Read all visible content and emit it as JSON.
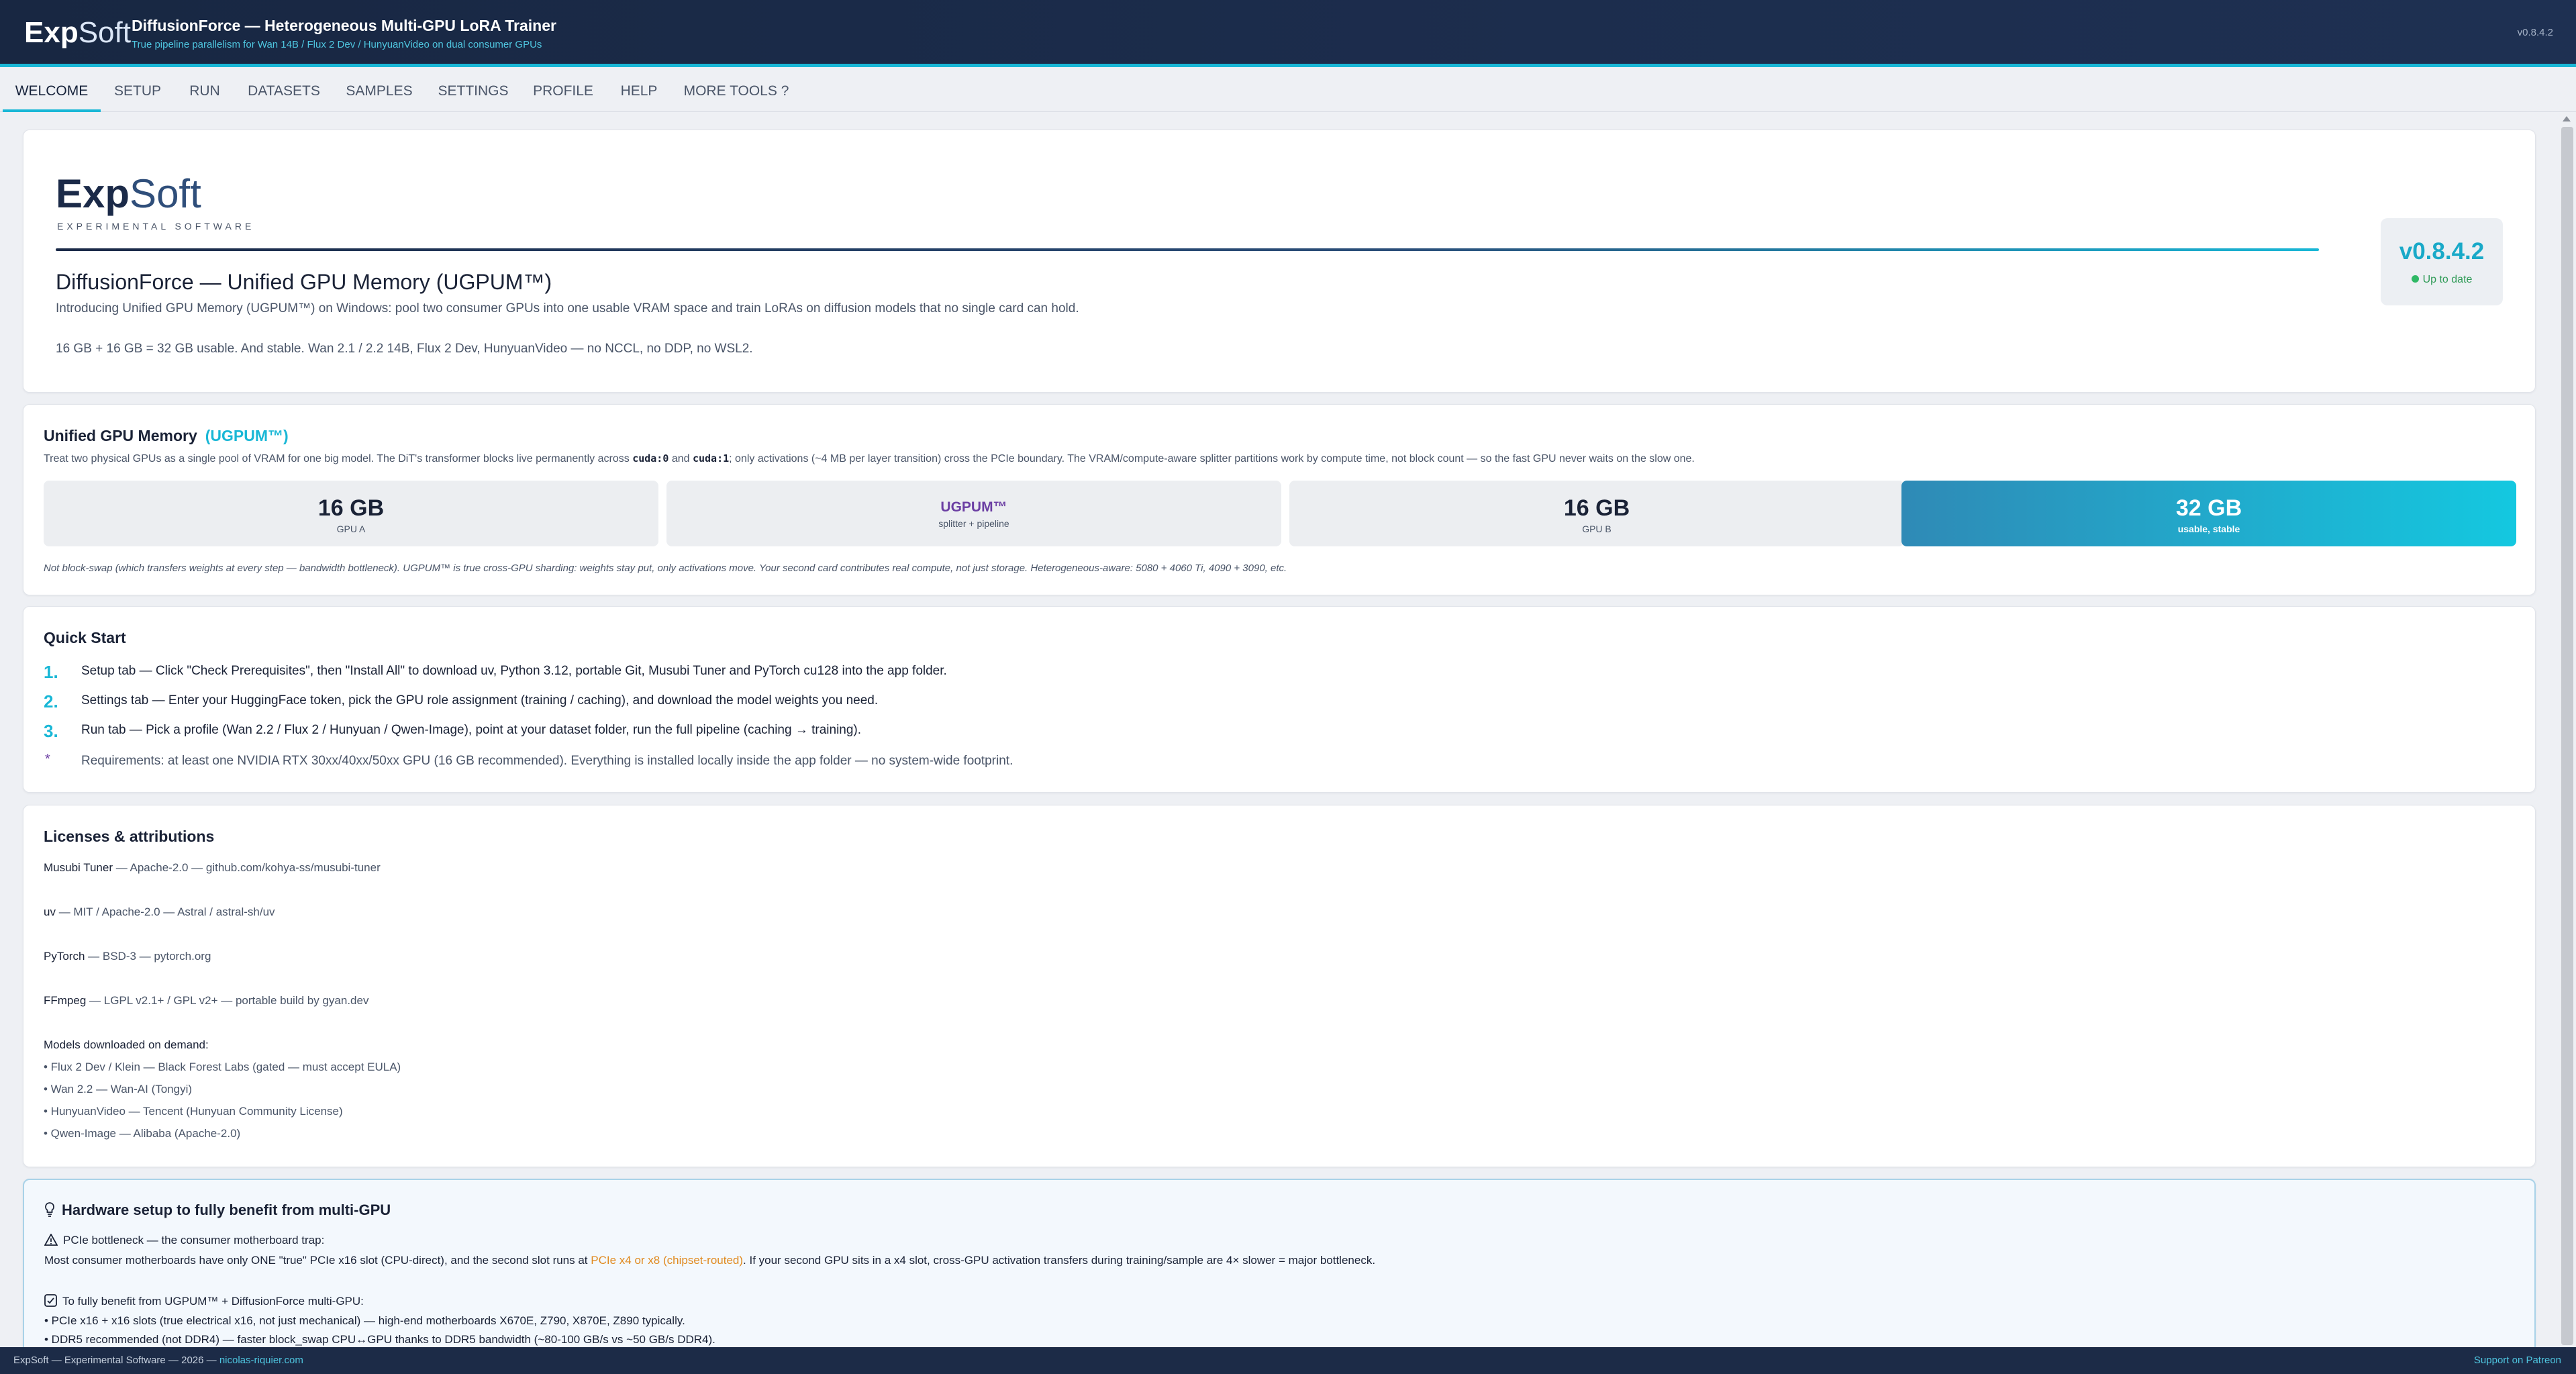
{
  "header": {
    "logo_bold": "Exp",
    "logo_light": "Soft",
    "title": "DiffusionForce — Heterogeneous Multi-GPU LoRA Trainer",
    "subtitle": "True pipeline parallelism for Wan 14B / Flux 2 Dev / HunyuanVideo on dual consumer GPUs",
    "version": "v0.8.4.2"
  },
  "tabs": [
    "WELCOME",
    "SETUP",
    "RUN",
    "DATASETS",
    "SAMPLES",
    "SETTINGS",
    "PROFILE",
    "HELP",
    "MORE TOOLS ?"
  ],
  "hero": {
    "logo_bold": "Exp",
    "logo_light": "Soft",
    "tagline": "EXPERIMENTAL SOFTWARE",
    "title": "DiffusionForce — Unified GPU Memory (UGPUM™)",
    "description": "Introducing Unified GPU Memory (UGPUM™) on Windows: pool two consumer GPUs into one usable VRAM space and train LoRAs on diffusion models that no single card can hold.",
    "stats": "16 GB + 16 GB = 32 GB usable. And stable. Wan 2.1 / 2.2 14B, Flux 2 Dev, HunyuanVideo — no NCCL, no DDP, no WSL2.",
    "version": "v0.8.4.2",
    "version_status": "Up to date"
  },
  "ugpum": {
    "title": "Unified GPU Memory",
    "title_accent": "(UGPUM™)",
    "desc_part1": "Treat two physical GPUs as a single pool of VRAM for one big model. The DiT's transformer blocks live permanently across ",
    "code1": "cuda:0",
    "desc_and": " and ",
    "code2": "cuda:1",
    "desc_part2": "; only activations (~4 MB per layer transition) cross the PCIe boundary. The VRAM/compute-aware splitter partitions work by compute time, not block count — so the fast GPU never waits on the slow one.",
    "boxes": [
      {
        "big": "16 GB",
        "small": "GPU A"
      },
      {
        "big": "UGPUM™",
        "small": "splitter + pipeline"
      },
      {
        "big": "16 GB",
        "small": "GPU B"
      },
      {
        "big": "32 GB",
        "small": "usable, stable"
      }
    ],
    "note": "Not block-swap (which transfers weights at every step — bandwidth bottleneck). UGPUM™ is true cross-GPU sharding: weights stay put, only activations move. Your second card contributes real compute, not just storage. Heterogeneous-aware: 5080 + 4060 Ti, 4090 + 3090, etc."
  },
  "quickstart": {
    "title": "Quick Start",
    "steps": [
      {
        "num": "1.",
        "text": "Setup tab — Click \"Check Prerequisites\", then \"Install All\" to download uv, Python 3.12, portable Git, Musubi Tuner and PyTorch cu128 into the app folder."
      },
      {
        "num": "2.",
        "text": "Settings tab — Enter your HuggingFace token, pick the GPU role assignment (training / caching), and download the model weights you need."
      },
      {
        "num": "3.",
        "text": "Run tab — Pick a profile (Wan 2.2 / Flux 2 / Hunyuan / Qwen-Image), point at your dataset folder, run the full pipeline (caching → training)."
      }
    ],
    "note_star": "*",
    "note": "Requirements: at least one NVIDIA RTX 30xx/40xx/50xx GPU (16 GB recommended). Everything is installed locally inside the app folder — no system-wide footprint."
  },
  "licenses": {
    "title": "Licenses & attributions",
    "items": [
      {
        "name": "Musubi Tuner",
        "detail": " — Apache-2.0 — github.com/kohya-ss/musubi-tuner"
      },
      {
        "name": "uv",
        "detail": " — MIT / Apache-2.0 — Astral / astral-sh/uv"
      },
      {
        "name": "PyTorch",
        "detail": " — BSD-3 — pytorch.org"
      },
      {
        "name": "FFmpeg",
        "detail": " — LGPL v2.1+ / GPL v2+ — portable build by gyan.dev"
      }
    ],
    "models_header": "Models downloaded on demand:",
    "models": [
      "• Flux 2 Dev / Klein — Black Forest Labs (gated — must accept EULA)",
      "• Wan 2.2 — Wan-AI (Tongyi)",
      "• HunyuanVideo — Tencent (Hunyuan Community License)",
      "• Qwen-Image — Alibaba (Apache-2.0)"
    ]
  },
  "hardware": {
    "title": "Hardware setup to fully benefit from multi-GPU",
    "warning_title": "PCIe bottleneck — the consumer motherboard trap:",
    "warning_part1": "Most consumer motherboards have only ONE \"true\" PCIe x16 slot (CPU-direct), and the second slot runs at ",
    "warning_highlight": "PCIe x4 or x8 (chipset-routed)",
    "warning_part2": ". If your second GPU sits in a x4 slot, cross-GPU activation transfers during training/sample are 4× slower = major bottleneck.",
    "benefit_title": "To fully benefit from UGPUM™ + DiffusionForce multi-GPU:",
    "bullet1": "• PCIe x16 + x16 slots (true electrical x16, not just mechanical) — high-end motherboards X670E, Z790, X870E, Z890 typically.",
    "bullet2": "• DDR5 recommended (not DDR4) — faster block_swap CPU↔GPU thanks to DDR5 bandwidth (~80-100 GB/s vs ~50 GB/s DDR4).",
    "highlight_color": "#e0891e"
  },
  "footer": {
    "left": "ExpSoft — Experimental Software — 2026 — ",
    "link": "nicolas-riquier.com",
    "right": "Support on Patreon"
  },
  "colors": {
    "accent": "#19b7d6",
    "header_bg": "#1c2d4d",
    "purple": "#6b3ea3",
    "success": "#2fb865"
  }
}
